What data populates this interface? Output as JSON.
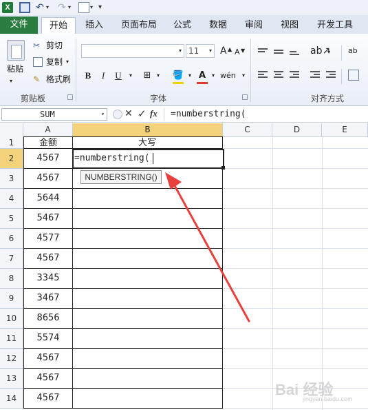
{
  "qat": {
    "customize_label": "▾"
  },
  "tabs": [
    "文件",
    "开始",
    "插入",
    "页面布局",
    "公式",
    "数据",
    "审阅",
    "视图",
    "开发工具"
  ],
  "ribbon": {
    "paste_label": "粘贴",
    "cut_label": "剪切",
    "copy_label": "复制",
    "format_painter_label": "格式刷",
    "clipboard_group": "剪贴板",
    "font_group": "字体",
    "alignment_group": "对齐方式",
    "font_size": "11",
    "grow_font": "A",
    "shrink_font": "A",
    "bold": "B",
    "italic": "I",
    "underline": "U",
    "wrap_icon": "ab"
  },
  "formula_bar": {
    "name_box": "SUM",
    "fx_label": "fx",
    "formula": "=numberstring("
  },
  "sheet": {
    "columns": [
      "A",
      "B",
      "C",
      "D",
      "E"
    ],
    "rows": [
      "1",
      "2",
      "3",
      "4",
      "5",
      "6",
      "7",
      "8",
      "9",
      "10",
      "11",
      "12",
      "13",
      "14"
    ],
    "header_A": "金额",
    "header_B": "大写",
    "active_cell_text": "=numberstring(",
    "values_A": [
      "4567",
      "4567",
      "5644",
      "5467",
      "4577",
      "4567",
      "3345",
      "3467",
      "8656",
      "5574",
      "4567",
      "4567",
      "4567"
    ],
    "tooltip": "NUMBERSTRING()"
  },
  "watermark": {
    "brand": "Bai 经验",
    "url": "jingyan.baidu.com"
  },
  "colors": {
    "file_tab": "#2a7d3f",
    "selection": "#f3d27a",
    "arrow": "#e8403c"
  }
}
